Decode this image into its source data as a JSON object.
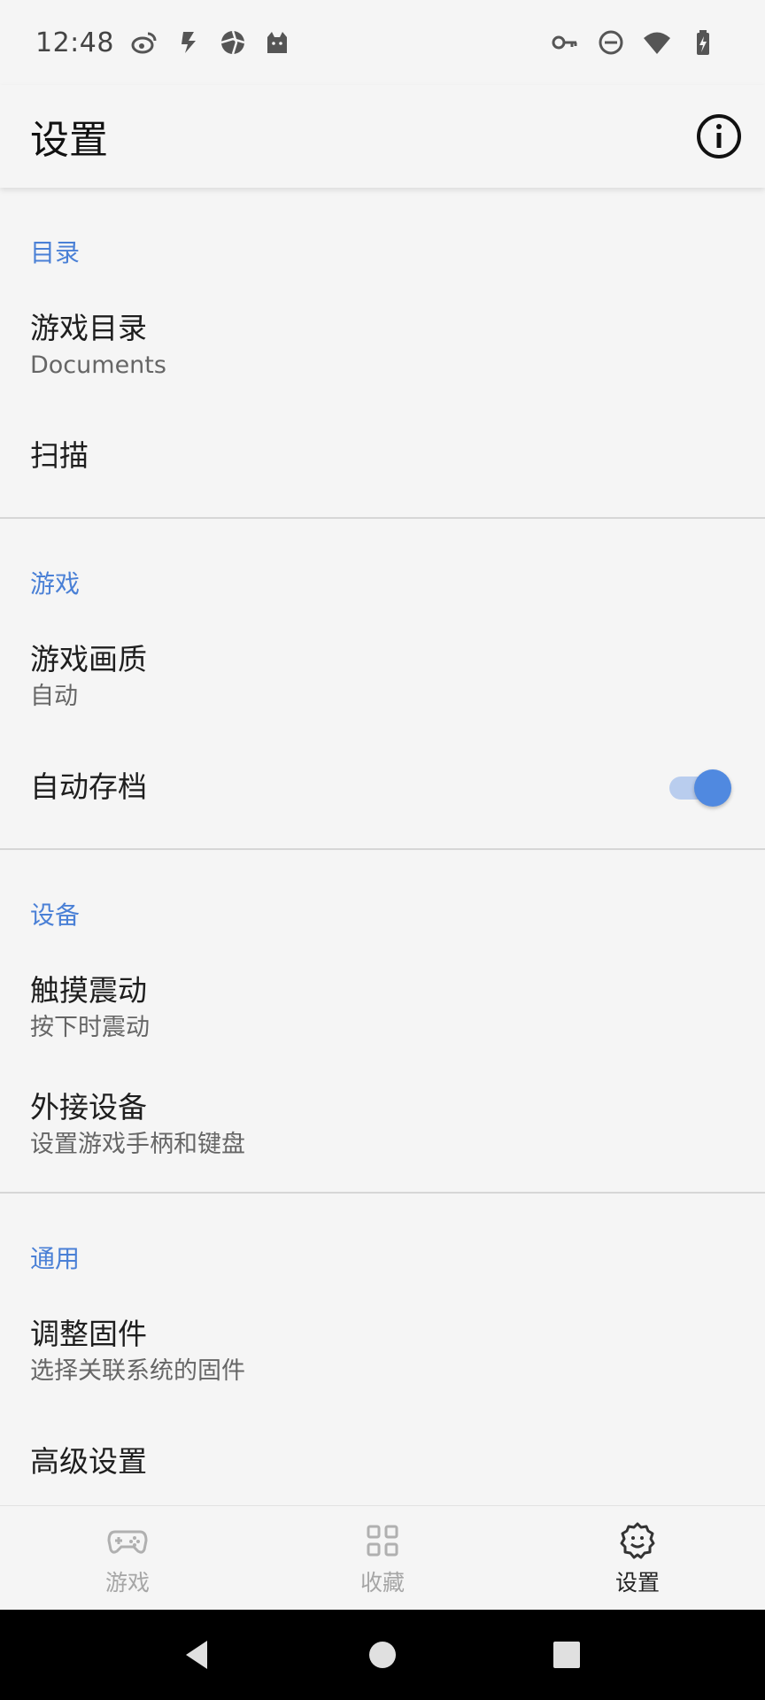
{
  "status_bar": {
    "time": "12:48",
    "left_icons": [
      "weibo-icon",
      "lightning-icon",
      "aperture-icon",
      "cat-icon"
    ],
    "right_icons": [
      "key-icon",
      "do-not-disturb-icon",
      "wifi-icon",
      "battery-charging-icon"
    ]
  },
  "app_bar": {
    "title": "设置",
    "action_icon": "info-icon"
  },
  "sections": [
    {
      "header": "目录",
      "items": [
        {
          "title": "游戏目录",
          "summary": "Documents"
        },
        {
          "title": "扫描"
        }
      ]
    },
    {
      "header": "游戏",
      "items": [
        {
          "title": "游戏画质",
          "summary": "自动"
        },
        {
          "title": "自动存档",
          "toggle": true
        }
      ]
    },
    {
      "header": "设备",
      "items": [
        {
          "title": "触摸震动",
          "summary": "按下时震动"
        },
        {
          "title": "外接设备",
          "summary": "设置游戏手柄和键盘"
        }
      ]
    },
    {
      "header": "通用",
      "items": [
        {
          "title": "调整固件",
          "summary": "选择关联系统的固件"
        },
        {
          "title": "高级设置"
        }
      ]
    }
  ],
  "bottom_nav": {
    "items": [
      {
        "label": "游戏",
        "icon": "gamepad-icon",
        "active": false
      },
      {
        "label": "收藏",
        "icon": "grid-icon",
        "active": false
      },
      {
        "label": "设置",
        "icon": "settings-icon",
        "active": true
      }
    ]
  },
  "colors": {
    "accent": "#4a80d6",
    "toggle_thumb": "#5089e0",
    "background": "#f5f5f5"
  }
}
